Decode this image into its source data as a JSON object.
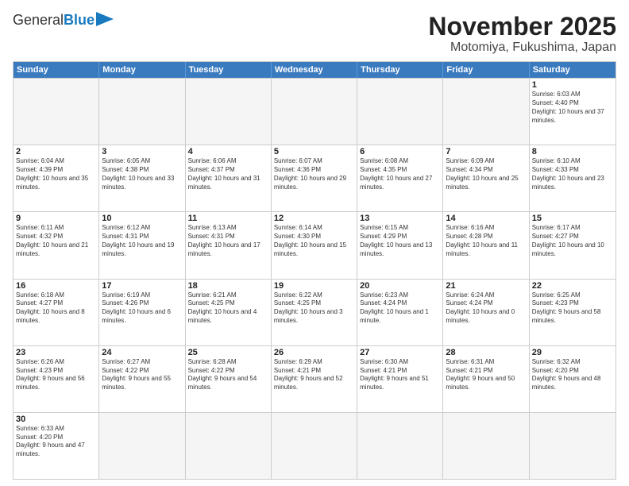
{
  "header": {
    "logo_general": "General",
    "logo_blue": "Blue",
    "title": "November 2025",
    "subtitle": "Motomiya, Fukushima, Japan"
  },
  "weekdays": [
    "Sunday",
    "Monday",
    "Tuesday",
    "Wednesday",
    "Thursday",
    "Friday",
    "Saturday"
  ],
  "rows": [
    [
      {
        "day": "",
        "empty": true
      },
      {
        "day": "",
        "empty": true
      },
      {
        "day": "",
        "empty": true
      },
      {
        "day": "",
        "empty": true
      },
      {
        "day": "",
        "empty": true
      },
      {
        "day": "",
        "empty": true
      },
      {
        "day": "1",
        "info": "Sunrise: 6:03 AM\nSunset: 4:40 PM\nDaylight: 10 hours and 37 minutes."
      }
    ],
    [
      {
        "day": "2",
        "info": "Sunrise: 6:04 AM\nSunset: 4:39 PM\nDaylight: 10 hours and 35 minutes."
      },
      {
        "day": "3",
        "info": "Sunrise: 6:05 AM\nSunset: 4:38 PM\nDaylight: 10 hours and 33 minutes."
      },
      {
        "day": "4",
        "info": "Sunrise: 6:06 AM\nSunset: 4:37 PM\nDaylight: 10 hours and 31 minutes."
      },
      {
        "day": "5",
        "info": "Sunrise: 6:07 AM\nSunset: 4:36 PM\nDaylight: 10 hours and 29 minutes."
      },
      {
        "day": "6",
        "info": "Sunrise: 6:08 AM\nSunset: 4:35 PM\nDaylight: 10 hours and 27 minutes."
      },
      {
        "day": "7",
        "info": "Sunrise: 6:09 AM\nSunset: 4:34 PM\nDaylight: 10 hours and 25 minutes."
      },
      {
        "day": "8",
        "info": "Sunrise: 6:10 AM\nSunset: 4:33 PM\nDaylight: 10 hours and 23 minutes."
      }
    ],
    [
      {
        "day": "9",
        "info": "Sunrise: 6:11 AM\nSunset: 4:32 PM\nDaylight: 10 hours and 21 minutes."
      },
      {
        "day": "10",
        "info": "Sunrise: 6:12 AM\nSunset: 4:31 PM\nDaylight: 10 hours and 19 minutes."
      },
      {
        "day": "11",
        "info": "Sunrise: 6:13 AM\nSunset: 4:31 PM\nDaylight: 10 hours and 17 minutes."
      },
      {
        "day": "12",
        "info": "Sunrise: 6:14 AM\nSunset: 4:30 PM\nDaylight: 10 hours and 15 minutes."
      },
      {
        "day": "13",
        "info": "Sunrise: 6:15 AM\nSunset: 4:29 PM\nDaylight: 10 hours and 13 minutes."
      },
      {
        "day": "14",
        "info": "Sunrise: 6:16 AM\nSunset: 4:28 PM\nDaylight: 10 hours and 11 minutes."
      },
      {
        "day": "15",
        "info": "Sunrise: 6:17 AM\nSunset: 4:27 PM\nDaylight: 10 hours and 10 minutes."
      }
    ],
    [
      {
        "day": "16",
        "info": "Sunrise: 6:18 AM\nSunset: 4:27 PM\nDaylight: 10 hours and 8 minutes."
      },
      {
        "day": "17",
        "info": "Sunrise: 6:19 AM\nSunset: 4:26 PM\nDaylight: 10 hours and 6 minutes."
      },
      {
        "day": "18",
        "info": "Sunrise: 6:21 AM\nSunset: 4:25 PM\nDaylight: 10 hours and 4 minutes."
      },
      {
        "day": "19",
        "info": "Sunrise: 6:22 AM\nSunset: 4:25 PM\nDaylight: 10 hours and 3 minutes."
      },
      {
        "day": "20",
        "info": "Sunrise: 6:23 AM\nSunset: 4:24 PM\nDaylight: 10 hours and 1 minute."
      },
      {
        "day": "21",
        "info": "Sunrise: 6:24 AM\nSunset: 4:24 PM\nDaylight: 10 hours and 0 minutes."
      },
      {
        "day": "22",
        "info": "Sunrise: 6:25 AM\nSunset: 4:23 PM\nDaylight: 9 hours and 58 minutes."
      }
    ],
    [
      {
        "day": "23",
        "info": "Sunrise: 6:26 AM\nSunset: 4:23 PM\nDaylight: 9 hours and 56 minutes."
      },
      {
        "day": "24",
        "info": "Sunrise: 6:27 AM\nSunset: 4:22 PM\nDaylight: 9 hours and 55 minutes."
      },
      {
        "day": "25",
        "info": "Sunrise: 6:28 AM\nSunset: 4:22 PM\nDaylight: 9 hours and 54 minutes."
      },
      {
        "day": "26",
        "info": "Sunrise: 6:29 AM\nSunset: 4:21 PM\nDaylight: 9 hours and 52 minutes."
      },
      {
        "day": "27",
        "info": "Sunrise: 6:30 AM\nSunset: 4:21 PM\nDaylight: 9 hours and 51 minutes."
      },
      {
        "day": "28",
        "info": "Sunrise: 6:31 AM\nSunset: 4:21 PM\nDaylight: 9 hours and 50 minutes."
      },
      {
        "day": "29",
        "info": "Sunrise: 6:32 AM\nSunset: 4:20 PM\nDaylight: 9 hours and 48 minutes."
      }
    ],
    [
      {
        "day": "30",
        "info": "Sunrise: 6:33 AM\nSunset: 4:20 PM\nDaylight: 9 hours and 47 minutes."
      },
      {
        "day": "",
        "empty": true
      },
      {
        "day": "",
        "empty": true
      },
      {
        "day": "",
        "empty": true
      },
      {
        "day": "",
        "empty": true
      },
      {
        "day": "",
        "empty": true
      },
      {
        "day": "",
        "empty": true
      }
    ]
  ]
}
